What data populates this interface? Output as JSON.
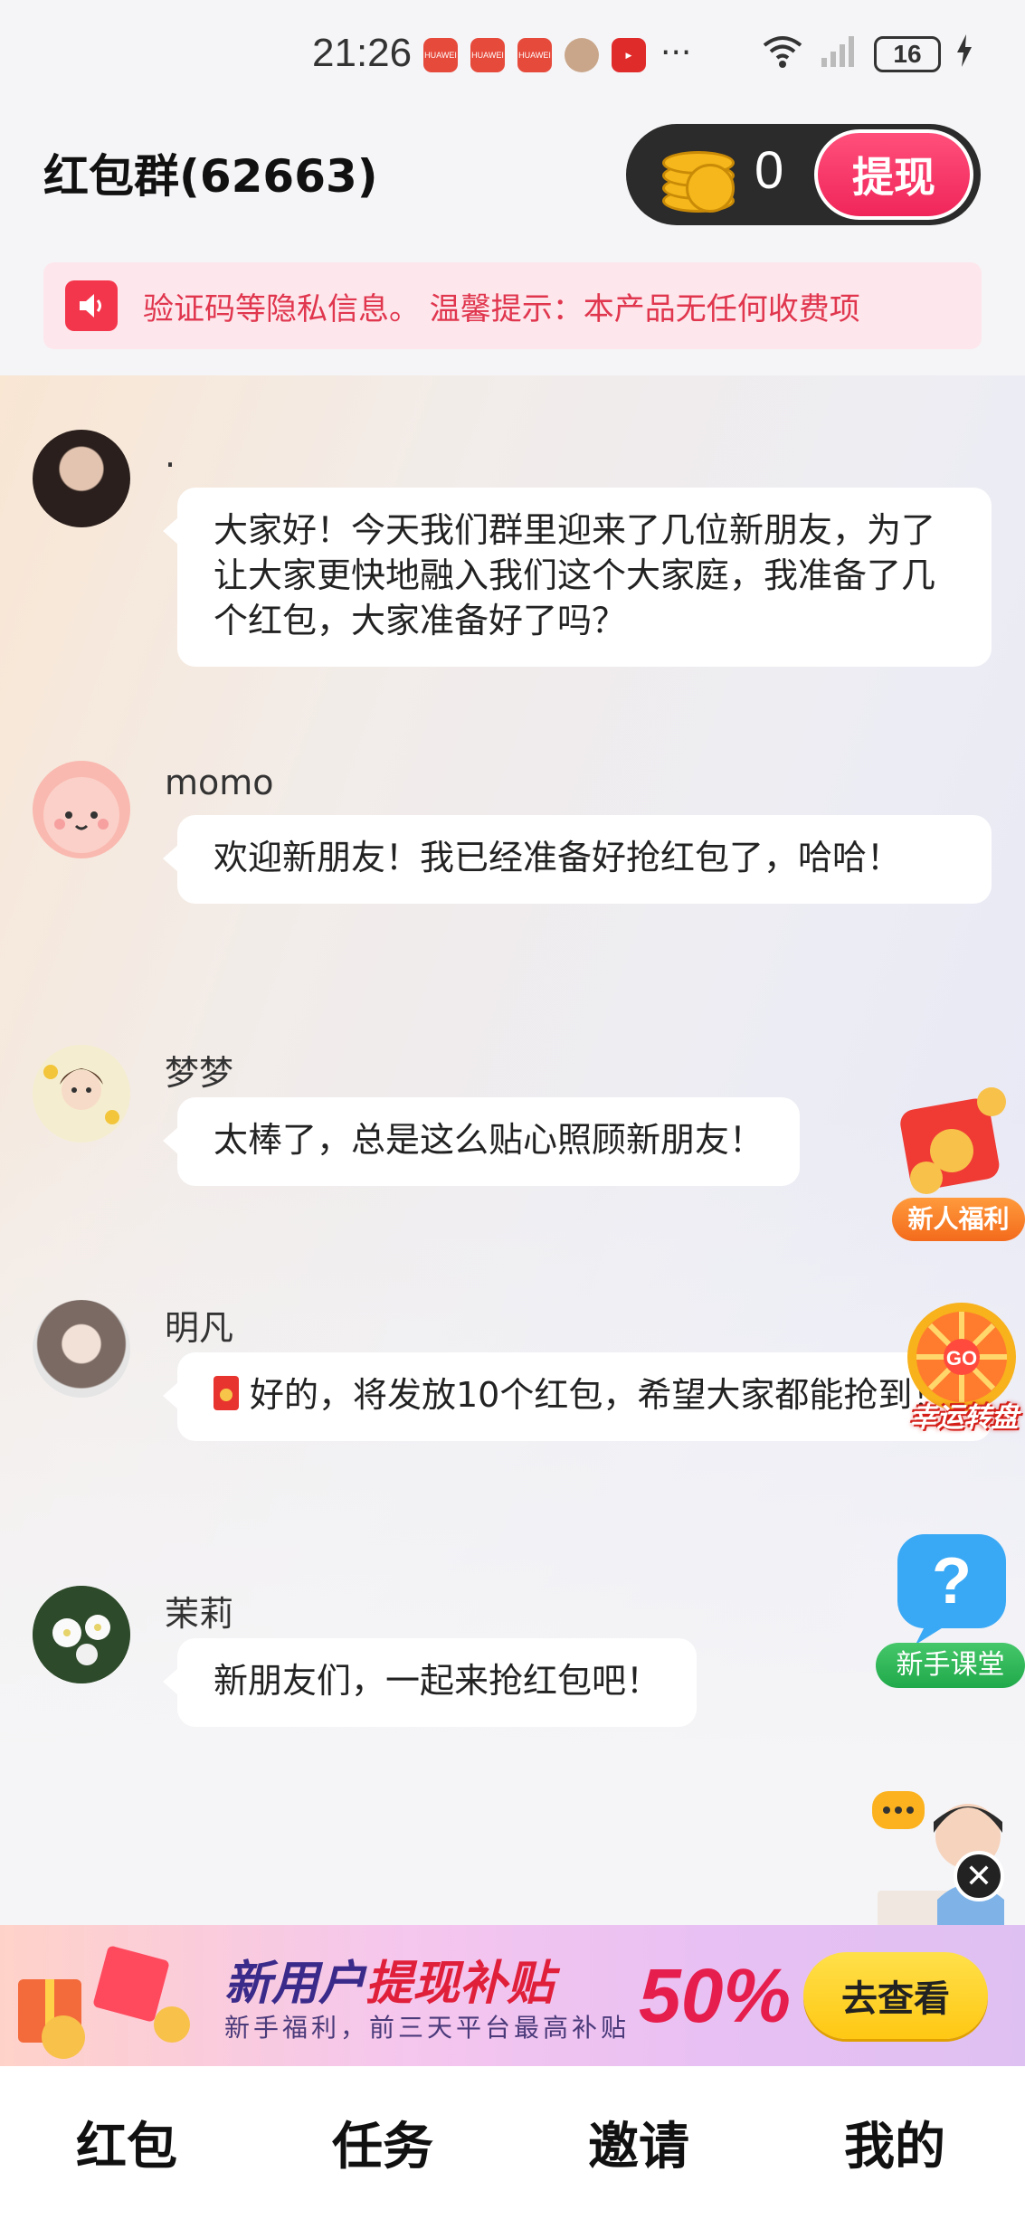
{
  "status_bar": {
    "time": "21:26",
    "app_icons": [
      "HUAWEI",
      "HUAWEI",
      "HUAWEI",
      "avatar",
      "video"
    ],
    "overflow": "···",
    "network": "6",
    "battery": "16"
  },
  "header": {
    "title": "红包群(62663)",
    "coin_count": "0",
    "withdraw_label": "提现"
  },
  "notice": {
    "text": "验证码等隐私信息。          温馨提示：本产品无任何收费项"
  },
  "messages": [
    {
      "sender": ".",
      "text": "大家好！今天我们群里迎来了几位新朋友，为了让大家更快地融入我们这个大家庭，我准备了几个红包，大家准备好了吗？"
    },
    {
      "sender": "momo",
      "text": "欢迎新朋友！我已经准备好抢红包了，哈哈！"
    },
    {
      "sender": "梦梦",
      "text": "太棒了，总是这么贴心照顾新朋友！"
    },
    {
      "sender": "明凡",
      "text": "好的，将发放10个红包，希望大家都能抢到！"
    },
    {
      "sender": "茉莉",
      "text": "新朋友们，一起来抢红包吧！"
    }
  ],
  "floating": {
    "newcomer_benefit": "新人福利",
    "lucky_wheel": "幸运转盘",
    "wheel_go": "GO",
    "newbie_class": "新手课堂"
  },
  "banner": {
    "title_a": "新用户",
    "title_b": "提现补贴",
    "percent": "50%",
    "subtitle": "新手福利，前三天平台最高补贴",
    "button": "去查看"
  },
  "nav": [
    {
      "label": "红包"
    },
    {
      "label": "任务"
    },
    {
      "label": "邀请"
    },
    {
      "label": "我的"
    }
  ],
  "colors": {
    "accent": "#f0265a",
    "notice_bg": "#fde7ec",
    "nav_active": "#9c8cf0"
  }
}
